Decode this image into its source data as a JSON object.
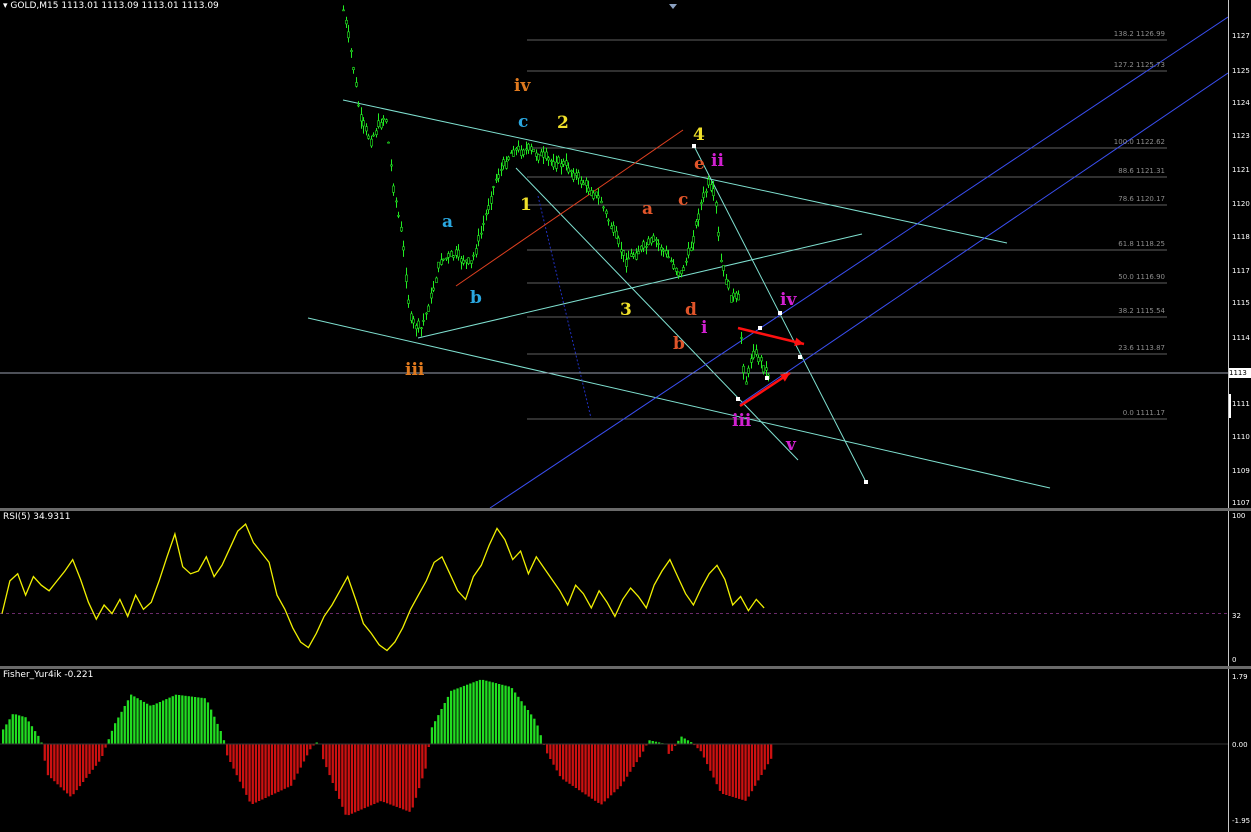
{
  "symbol_header": "GOLD,M15  1113.01 1113.09 1113.01 1113.09",
  "price_axis": [
    "1127",
    "1125",
    "1124",
    "1123",
    "1121",
    "1120",
    "1118",
    "1117",
    "1115",
    "1114",
    "1112",
    "1111",
    "1110",
    "1109",
    "1107"
  ],
  "current_price_tag": "1113",
  "fib_levels": [
    {
      "label": "138.2  1126.99"
    },
    {
      "label": "127.2  1125.73"
    },
    {
      "label": "100.0  1122.62"
    },
    {
      "label": "88.6  1121.31"
    },
    {
      "label": "78.6  1120.17"
    },
    {
      "label": "61.8  1118.25"
    },
    {
      "label": "50.0  1116.90"
    },
    {
      "label": "38.2  1115.54"
    },
    {
      "label": "23.6  1113.87"
    },
    {
      "label": "0.0  1111.17"
    }
  ],
  "wave_labels": [
    {
      "text": "iv",
      "color": "#e07a1f"
    },
    {
      "text": "iii",
      "color": "#e07a1f"
    },
    {
      "text": "c",
      "color": "#2aa7e0"
    },
    {
      "text": "a",
      "color": "#2aa7e0"
    },
    {
      "text": "b",
      "color": "#2aa7e0"
    },
    {
      "text": "2",
      "color": "#f0e02a"
    },
    {
      "text": "1",
      "color": "#f0e02a"
    },
    {
      "text": "3",
      "color": "#f0e02a"
    },
    {
      "text": "4",
      "color": "#f0e02a"
    },
    {
      "text": "a",
      "color": "#e0552a"
    },
    {
      "text": "c",
      "color": "#e0552a"
    },
    {
      "text": "e",
      "color": "#e0552a"
    },
    {
      "text": "d",
      "color": "#e0552a"
    },
    {
      "text": "b",
      "color": "#e0552a"
    },
    {
      "text": "ii",
      "color": "#d020d0"
    },
    {
      "text": "i",
      "color": "#d020d0"
    },
    {
      "text": "iii",
      "color": "#d020d0"
    },
    {
      "text": "iv",
      "color": "#d020d0"
    },
    {
      "text": "v",
      "color": "#d020d0"
    }
  ],
  "rsi": {
    "label": "RSI(5) 34.9311",
    "axis": [
      "100",
      "32",
      "0"
    ],
    "level": 32,
    "color": "#f0f000"
  },
  "fisher": {
    "label": "Fisher_Yur4ik -0.221",
    "axis": [
      "1.79",
      "0.00",
      "-1.95"
    ],
    "pos_color": "#22dd22",
    "neg_color": "#cc1111"
  },
  "colors": {
    "candle": "#22ee22",
    "channel": "#7fe0d0",
    "blue_line": "#3a4ef0",
    "red_line": "#e04020",
    "fib_line": "#606060",
    "arrow": "#ff1010"
  }
}
